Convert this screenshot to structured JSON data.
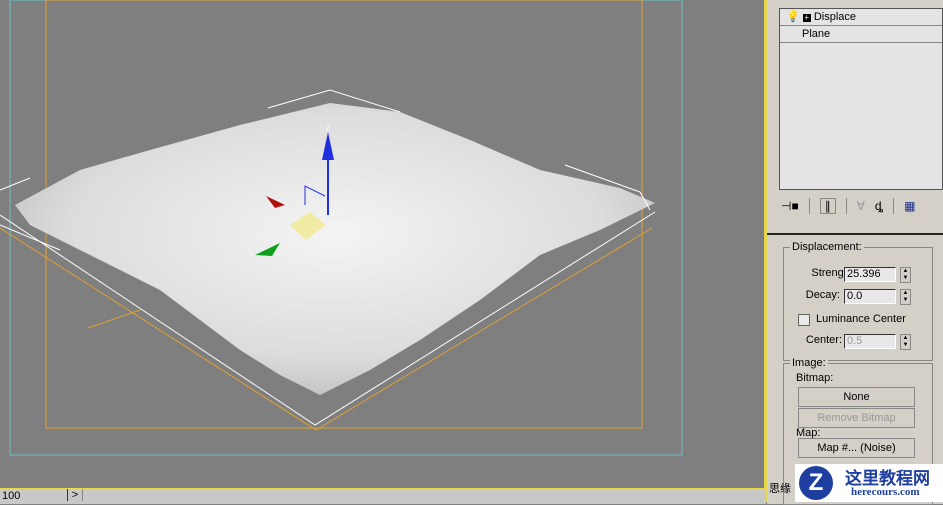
{
  "viewport": {
    "axis_label": "z",
    "colors": {
      "frame": "#e0a030",
      "safe": "#6ac0c8",
      "background": "#7f7f7f"
    }
  },
  "modifier_stack": {
    "items": [
      {
        "label": "Displace",
        "expanded_icon": "plus-box-icon",
        "light_icon": "bulb-icon"
      },
      {
        "label": "Plane"
      }
    ]
  },
  "stack_tools": [
    "pin-stack-icon",
    "show-end-result-icon",
    "make-unique-icon",
    "remove-modifier-icon",
    "configure-sets-icon"
  ],
  "displacement": {
    "title": "Displacement:",
    "strength_label": "Strength:",
    "strength": "25.396",
    "decay_label": "Decay:",
    "decay": "0.0",
    "luminance_center_label": "Luminance Center",
    "luminance_center_checked": false,
    "center_label": "Center:",
    "center": "0.5"
  },
  "image": {
    "title": "Image:",
    "bitmap_label": "Bitmap:",
    "bitmap_button": "None",
    "remove_bitmap": "Remove Bitmap",
    "map_label": "Map:",
    "map_button": "Map #... (Noise)"
  },
  "status": {
    "frame_value": "100",
    "next_arrow": ">",
    "left_text": "思缘"
  },
  "watermark": {
    "title": "这里教程网",
    "url": "herecours.com"
  }
}
